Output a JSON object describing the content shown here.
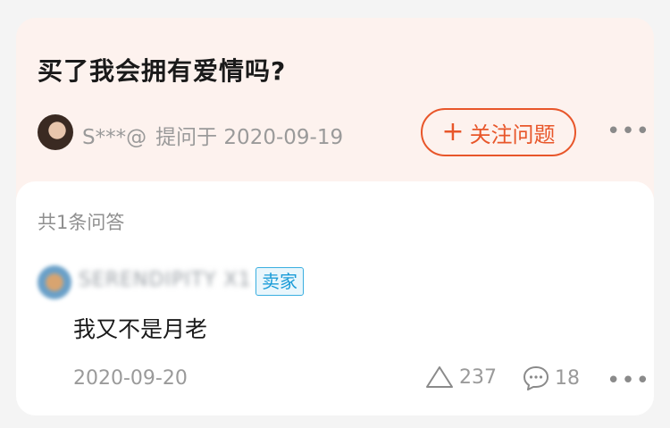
{
  "question": {
    "title": "买了我会拥有爱情吗?",
    "asker": "S***@",
    "asked_label": "提问于",
    "asked_date": "2020-09-19",
    "follow_icon": "plus-icon",
    "follow_label": "关注问题",
    "more_icon": "more-icon"
  },
  "answers": {
    "count_label": "共1条问答",
    "items": [
      {
        "author": "SERENDIPITY X1",
        "badge": "卖家",
        "text": "我又不是月老",
        "date": "2020-09-20",
        "likes": "237",
        "comments": "18"
      }
    ]
  },
  "colors": {
    "accent": "#e8562a",
    "question_bg": "#fdf2ee",
    "badge": "#1b9cd8"
  }
}
